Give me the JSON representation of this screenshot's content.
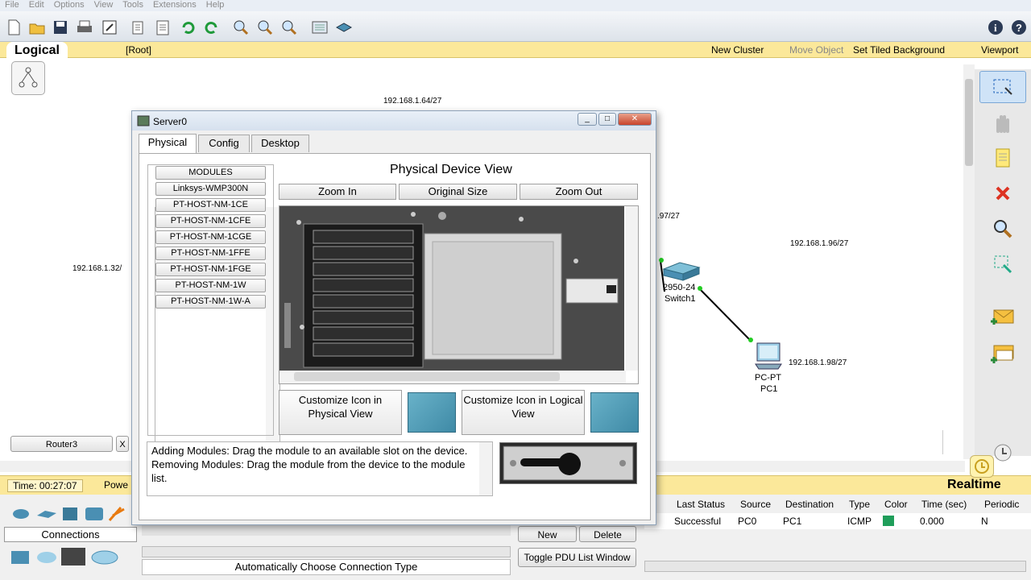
{
  "menu": [
    "File",
    "Edit",
    "Options",
    "View",
    "Tools",
    "Extensions",
    "Help"
  ],
  "workspace": {
    "tab": "Logical",
    "root": "[Root]",
    "new_cluster": "New Cluster",
    "move_object": "Move Object",
    "set_tiled_bg": "Set Tiled Background",
    "viewport": "Viewport"
  },
  "canvas": {
    "labels": {
      "net64": "192.168.1.64/27",
      "net32": "192.168.1.32/",
      "net96": "192.168.1.96/27",
      "net97": ".97/27",
      "pc1_ip": "192.168.1.98/27",
      "switch_model": "2950-24",
      "switch_name": "Switch1",
      "pc_model": "PC-PT",
      "pc_name": "PC1"
    },
    "router_tab": "Router3",
    "router_close": "X"
  },
  "status": {
    "time": "Time: 00:27:07",
    "power": "Powe",
    "mode": "Realtime"
  },
  "connections_label": "Connections",
  "auto_connection": "Automatically Choose Connection Type",
  "pdu": {
    "headers": [
      "Last Status",
      "Source",
      "Destination",
      "Type",
      "Color",
      "Time (sec)",
      "Periodic"
    ],
    "row": {
      "status": "Successful",
      "source": "PC0",
      "destination": "PC1",
      "type": "ICMP",
      "color": "#1f9e5a",
      "time": "0.000",
      "periodic": "N"
    },
    "new": "New",
    "delete": "Delete",
    "toggle": "Toggle PDU List Window"
  },
  "dialog": {
    "title": "Server0",
    "tabs": [
      "Physical",
      "Config",
      "Desktop"
    ],
    "modules_header": "MODULES",
    "modules": [
      "Linksys-WMP300N",
      "PT-HOST-NM-1CE",
      "PT-HOST-NM-1CFE",
      "PT-HOST-NM-1CGE",
      "PT-HOST-NM-1FFE",
      "PT-HOST-NM-1FGE",
      "PT-HOST-NM-1W",
      "PT-HOST-NM-1W-A"
    ],
    "view_title": "Physical Device View",
    "zoom_in": "Zoom In",
    "original_size": "Original Size",
    "zoom_out": "Zoom Out",
    "customize_physical": "Customize Icon in Physical View",
    "customize_logical": "Customize Icon in Logical View",
    "info": "Adding Modules: Drag the module to an available slot on the device. Removing Modules: Drag the module from the device to the module list."
  },
  "colors": {
    "accent_yellow": "#fbe89a",
    "switch_blue": "#4a8fb3",
    "link_green": "#22cc22"
  }
}
